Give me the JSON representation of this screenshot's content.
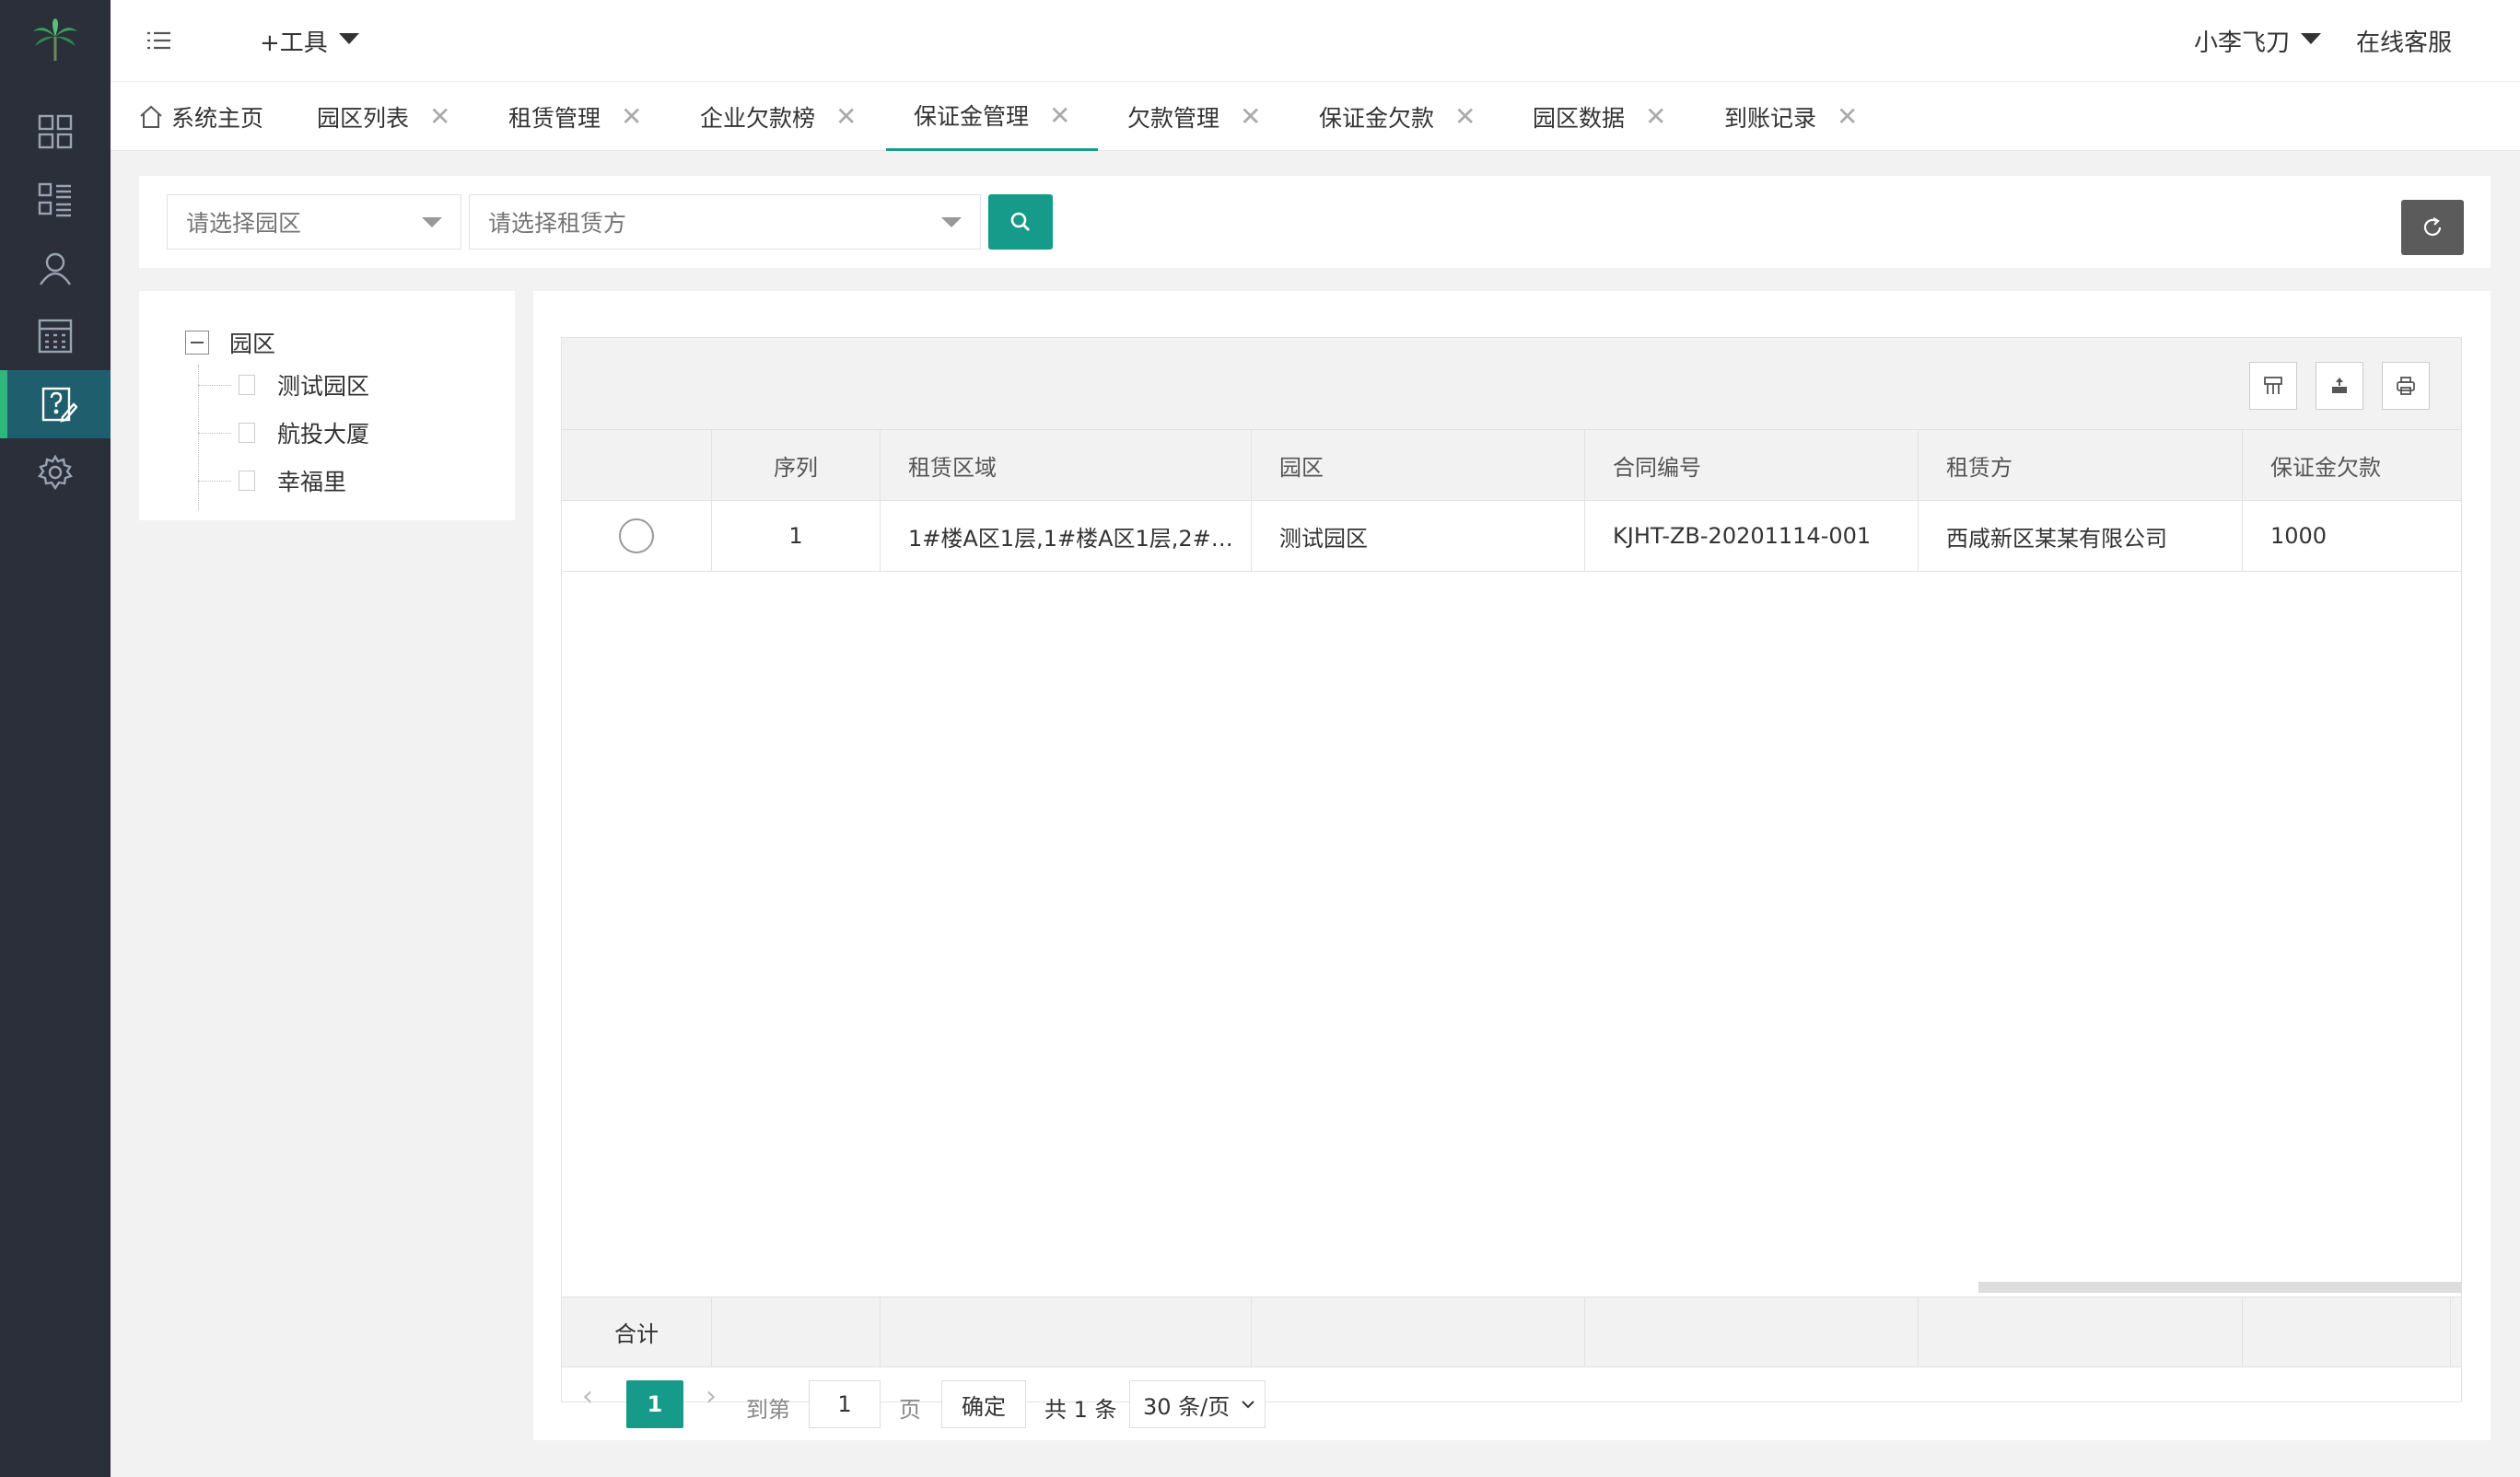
{
  "header": {
    "tools_label": "+工具",
    "user_name": "小李飞刀",
    "service_label": "在线客服"
  },
  "sidebar": {
    "items": [
      {
        "icon": "dashboard-icon"
      },
      {
        "icon": "list-icon"
      },
      {
        "icon": "user-icon"
      },
      {
        "icon": "calculator-icon"
      },
      {
        "icon": "help-edit-icon",
        "active": true
      },
      {
        "icon": "gear-icon"
      }
    ]
  },
  "tabs": [
    {
      "label": "系统主页",
      "home": true
    },
    {
      "label": "园区列表"
    },
    {
      "label": "租赁管理"
    },
    {
      "label": "企业欠款榜"
    },
    {
      "label": "保证金管理",
      "active": true
    },
    {
      "label": "欠款管理"
    },
    {
      "label": "保证金欠款"
    },
    {
      "label": "园区数据"
    },
    {
      "label": "到账记录"
    }
  ],
  "close_glyph": "✕",
  "search": {
    "park_placeholder": "请选择园区",
    "lessee_placeholder": "请选择租赁方"
  },
  "tree": {
    "root": "园区",
    "children": [
      "测试园区",
      "航投大厦",
      "幸福里"
    ]
  },
  "table": {
    "columns": [
      "序列",
      "租赁区域",
      "园区",
      "合同编号",
      "租赁方",
      "保证金欠款"
    ],
    "rows": [
      {
        "index": "1",
        "area": "1#楼A区1层,1#楼A区1层,2#…",
        "park": "测试园区",
        "contract": "KJHT-ZB-20201114-001",
        "lessee": "西咸新区某某有限公司",
        "deposit": "1000"
      }
    ],
    "footer_label": "合计"
  },
  "pager": {
    "current": "1",
    "goto_label": "到第",
    "goto_value": "1",
    "page_label": "页",
    "confirm": "确定",
    "total": "共 1 条",
    "page_size": "30 条/页"
  },
  "colors": {
    "accent": "#169a89",
    "sidebar_bg": "#2b2f3a",
    "sidebar_active": "#1f5f6d",
    "active_marker": "#2db77d"
  }
}
